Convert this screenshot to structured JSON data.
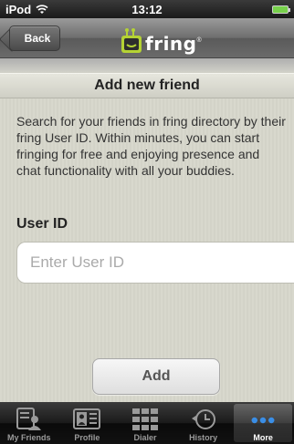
{
  "status_bar": {
    "carrier": "iPod",
    "time": "13:12"
  },
  "nav_bar": {
    "back_label": "Back",
    "logo_text": "fring",
    "logo_reg": "®"
  },
  "page": {
    "title": "Add new friend",
    "description": "Search for your friends in fring directory by their fring User ID. Within minutes, you can start fringing for free and enjoying presence and chat functionality with all your buddies.",
    "field_label": "User ID",
    "input_placeholder": "Enter User ID",
    "input_value": "",
    "add_label": "Add"
  },
  "tab_bar": {
    "tabs": [
      {
        "label": "My Friends",
        "icon": "friends-icon",
        "active": false
      },
      {
        "label": "Profile",
        "icon": "profile-card-icon",
        "active": false
      },
      {
        "label": "Dialer",
        "icon": "keypad-icon",
        "active": false
      },
      {
        "label": "History",
        "icon": "clock-history-icon",
        "active": false
      },
      {
        "label": "More",
        "icon": "more-dots-icon",
        "active": true
      }
    ]
  },
  "colors": {
    "active_tab_dots": "#3a8ee6",
    "battery": "#77d14b",
    "logo_green": "#b5d334"
  }
}
